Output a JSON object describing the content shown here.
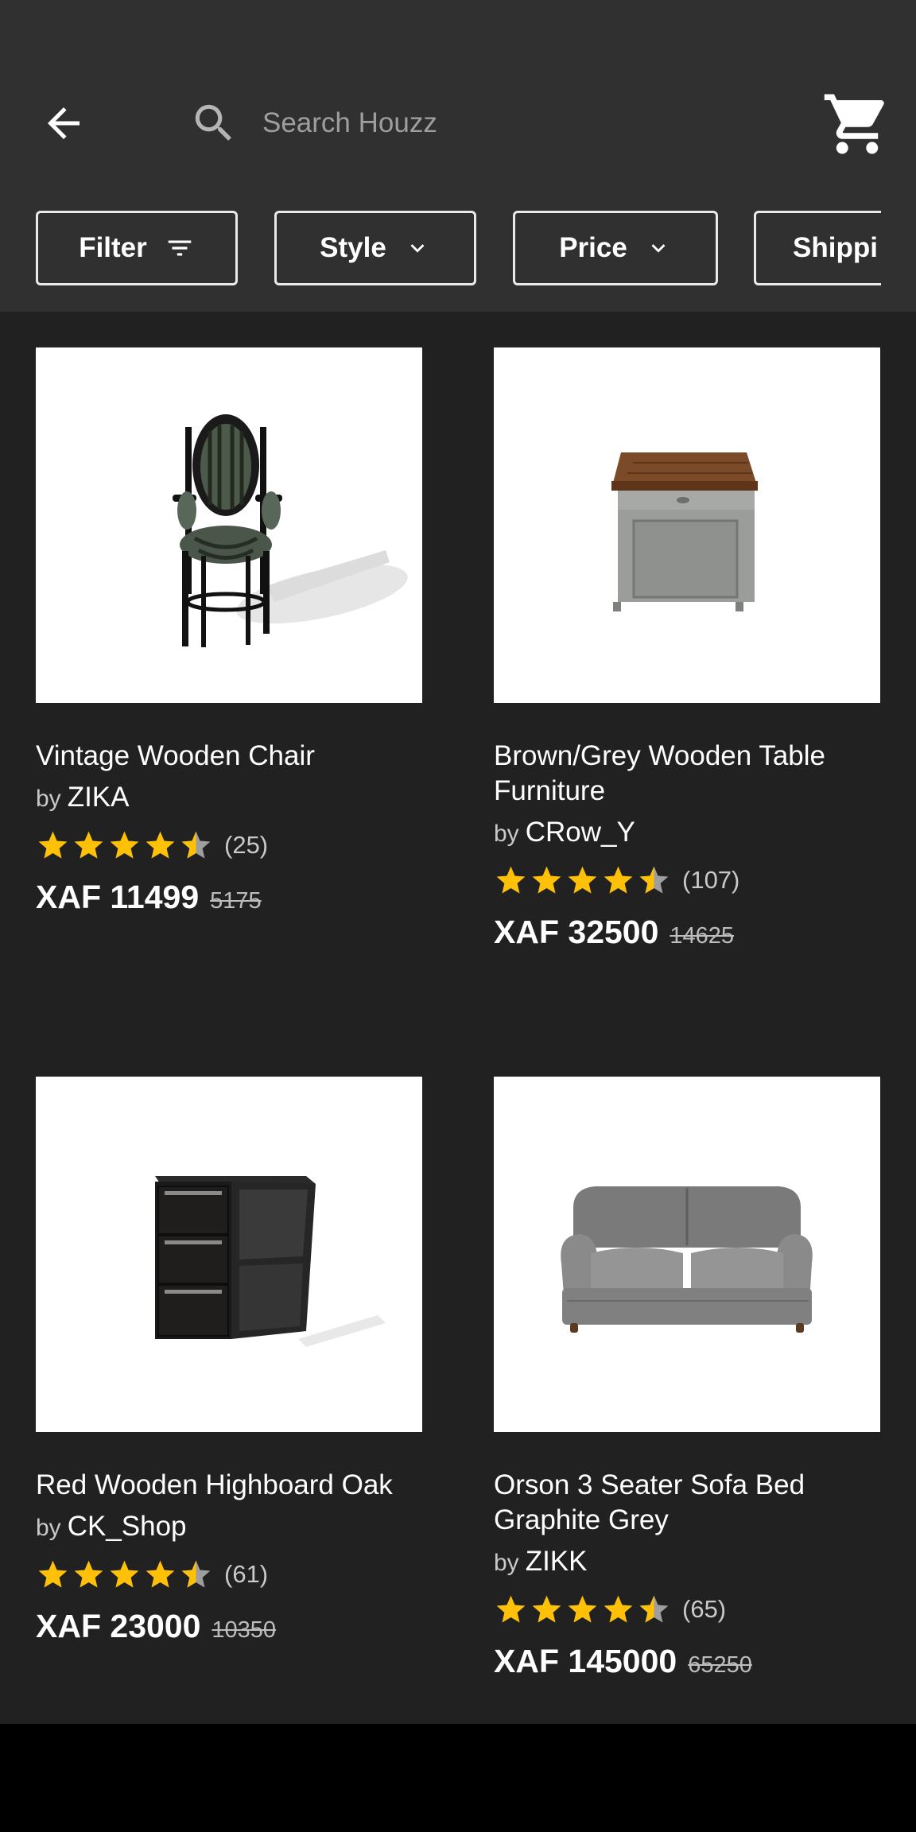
{
  "header": {
    "search": {
      "placeholder": "Search Houzz",
      "value": ""
    },
    "icons": {
      "back": "arrow-left-icon",
      "search": "search-icon",
      "cart": "shopping-cart-icon"
    }
  },
  "filters": [
    {
      "label": "Filter",
      "icon": "filter-lines-icon"
    },
    {
      "label": "Style",
      "icon": "chevron-down-icon"
    },
    {
      "label": "Price",
      "icon": "chevron-down-icon"
    },
    {
      "label": "Shippi"
    }
  ],
  "colors": {
    "header_bg": "#303030",
    "content_bg": "#212121",
    "star": "#FFC107",
    "star_empty": "#9E9E9E"
  },
  "products": [
    {
      "title": "Vintage Wooden Chair",
      "by": "by",
      "seller": "ZIKA",
      "rating": 4.5,
      "reviews": "(25)",
      "price": "XAF 11499",
      "old_price": "5175"
    },
    {
      "title": "Brown/Grey Wooden Table Furniture",
      "by": "by",
      "seller": "CRow_Y",
      "rating": 4.5,
      "reviews": "(107)",
      "price": "XAF 32500",
      "old_price": "14625"
    },
    {
      "title": "Red Wooden Highboard Oak",
      "by": "by",
      "seller": "CK_Shop",
      "rating": 4.5,
      "reviews": "(61)",
      "price": "XAF 23000",
      "old_price": "10350"
    },
    {
      "title": "Orson 3 Seater Sofa Bed Graphite Grey",
      "by": "by",
      "seller": "ZIKK",
      "rating": 4.5,
      "reviews": "(65)",
      "price": "XAF 145000",
      "old_price": "65250"
    }
  ]
}
